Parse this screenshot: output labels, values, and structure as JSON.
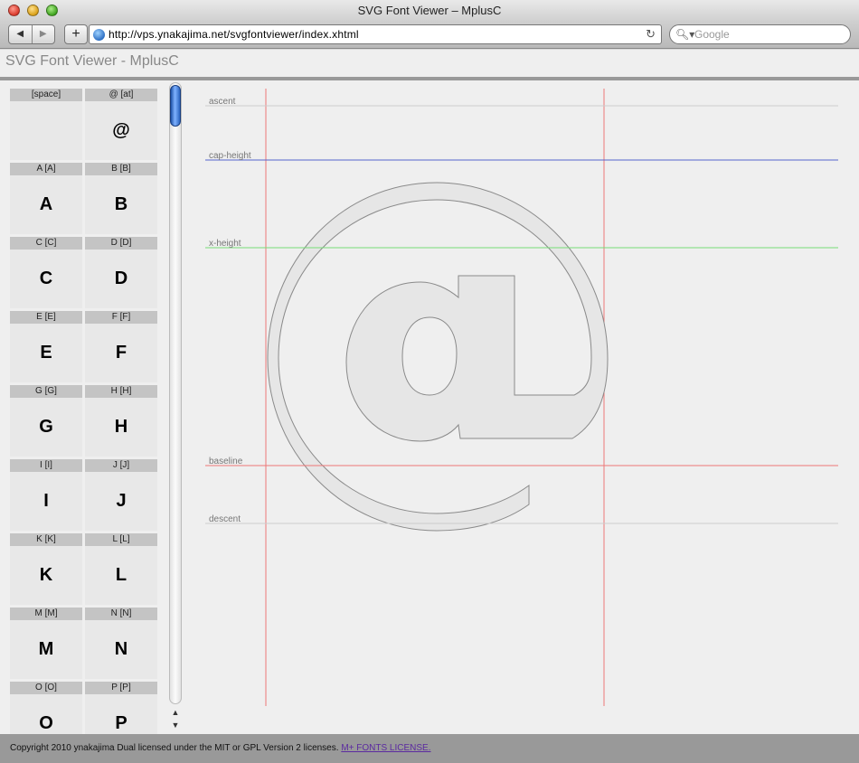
{
  "window": {
    "title": "SVG Font Viewer – MplusC"
  },
  "toolbar": {
    "back_glyph": "◀",
    "forward_glyph": "▶",
    "add_glyph": "+",
    "url": "http://vps.ynakajima.net/svgfontviewer/index.xhtml",
    "reload_glyph": "↻",
    "search_placeholder": "Google",
    "search_glyph": "🔍︎▾"
  },
  "page": {
    "title": "SVG Font Viewer - MplusC"
  },
  "glyphs": [
    {
      "label": "[space]",
      "char": ""
    },
    {
      "label": "@ [at]",
      "char": "@"
    },
    {
      "label": "A [A]",
      "char": "A"
    },
    {
      "label": "B [B]",
      "char": "B"
    },
    {
      "label": "C [C]",
      "char": "C"
    },
    {
      "label": "D [D]",
      "char": "D"
    },
    {
      "label": "E [E]",
      "char": "E"
    },
    {
      "label": "F [F]",
      "char": "F"
    },
    {
      "label": "G [G]",
      "char": "G"
    },
    {
      "label": "H [H]",
      "char": "H"
    },
    {
      "label": "I [I]",
      "char": "I"
    },
    {
      "label": "J [J]",
      "char": "J"
    },
    {
      "label": "K [K]",
      "char": "K"
    },
    {
      "label": "L [L]",
      "char": "L"
    },
    {
      "label": "M [M]",
      "char": "M"
    },
    {
      "label": "N [N]",
      "char": "N"
    },
    {
      "label": "O [O]",
      "char": "O"
    },
    {
      "label": "P [P]",
      "char": "P"
    }
  ],
  "viewer": {
    "selected_glyph": "@",
    "metrics": {
      "ascent": "ascent",
      "cap_height": "cap-height",
      "x_height": "x-height",
      "baseline": "baseline",
      "descent": "descent"
    },
    "colors": {
      "ascent": "#cccccc",
      "cap_height": "#5566cc",
      "x_height": "#77dd77",
      "baseline": "#ee7777",
      "descent": "#cccccc",
      "guide": "#ee7777"
    }
  },
  "scrollbar": {
    "up_glyph": "▲",
    "down_glyph": "▼"
  },
  "footer": {
    "text": "Copyright 2010 ynakajima Dual licensed under the MIT or GPL Version 2 licenses.",
    "link": "M+ FONTS LICENSE."
  }
}
